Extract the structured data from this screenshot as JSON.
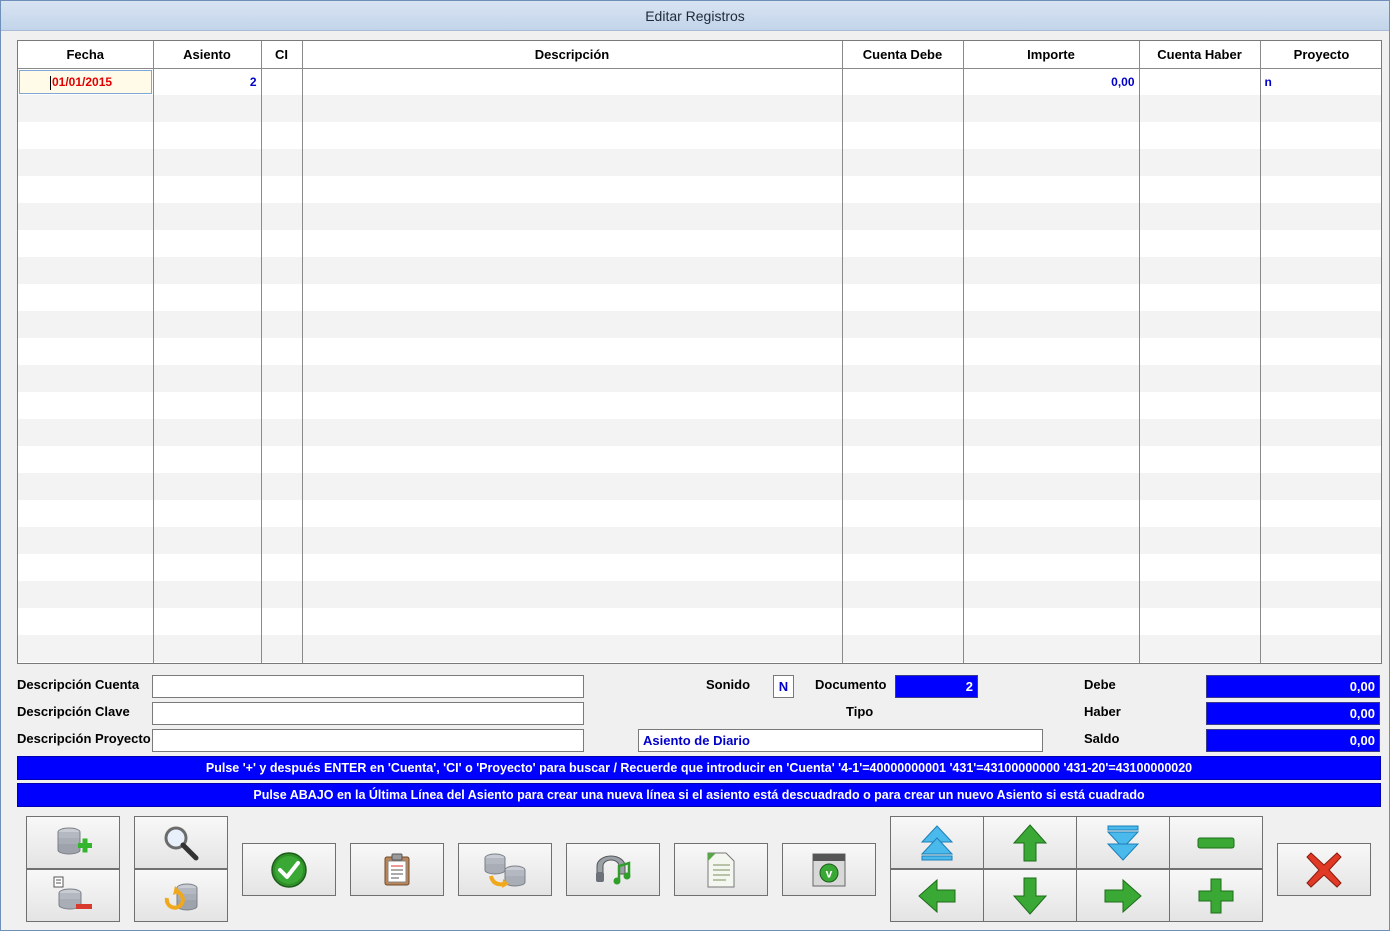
{
  "window": {
    "title": "Editar Registros"
  },
  "grid": {
    "columns": [
      "Fecha",
      "Asiento",
      "CI",
      "Descripción",
      "Cuenta Debe",
      "Importe",
      "Cuenta Haber",
      "Proyecto"
    ],
    "rows": [
      {
        "fecha": "01/01/2015",
        "asiento": "2",
        "ci": "",
        "descripcion": "",
        "cuenta_debe": "",
        "importe": "0,00",
        "cuenta_haber": "",
        "proyecto": "n"
      }
    ]
  },
  "fields": {
    "descripcion_cuenta_label": "Descripción Cuenta",
    "descripcion_cuenta_value": "",
    "descripcion_clave_label": "Descripción Clave",
    "descripcion_clave_value": "",
    "descripcion_proyecto_label": "Descripción Proyecto",
    "descripcion_proyecto_value": "",
    "sonido_label": "Sonido",
    "sonido_value": "N",
    "documento_label": "Documento",
    "documento_value": "2",
    "tipo_label": "Tipo",
    "tipo_value": "Asiento de Diario",
    "debe_label": "Debe",
    "debe_value": "0,00",
    "haber_label": "Haber",
    "haber_value": "0,00",
    "saldo_label": "Saldo",
    "saldo_value": "0,00"
  },
  "banners": {
    "line1": "Pulse '+' y después ENTER en 'Cuenta', 'CI' o 'Proyecto' para buscar / Recuerde que introducir en 'Cuenta' '4-1'=40000000001  '431'=43100000000 '431-20'=43100000020",
    "line2": "Pulse ABAJO en la Última Línea del Asiento para crear una nueva línea si el asiento está descuadrado o para crear un nuevo Asiento si está cuadrado"
  },
  "toolbar": {
    "icons": [
      "add-record-icon",
      "delete-record-icon",
      "search-icon",
      "refresh-database-icon",
      "accept-check-icon",
      "clipboard-icon",
      "database-import-icon",
      "sound-icon",
      "document-icon",
      "validate-document-icon",
      "first-icon",
      "up-arrow-icon",
      "last-icon",
      "minus-icon",
      "left-arrow-icon",
      "down-arrow-icon",
      "right-arrow-icon",
      "plus-icon",
      "close-icon"
    ]
  }
}
